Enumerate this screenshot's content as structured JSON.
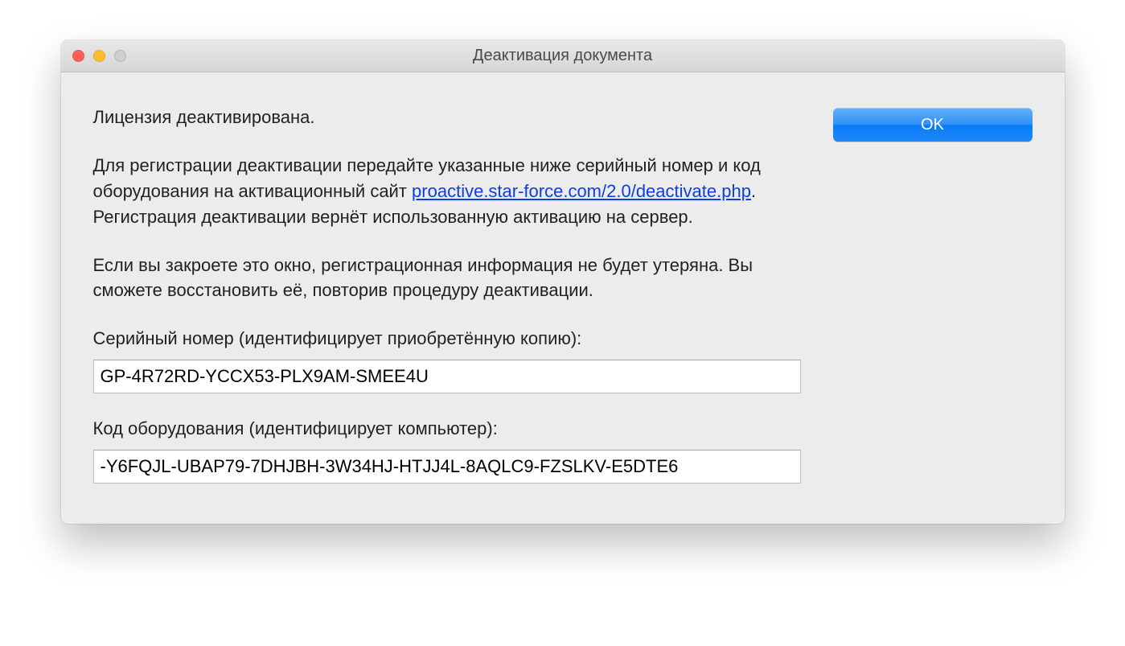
{
  "window": {
    "title": "Деактивация документа"
  },
  "body": {
    "para1": "Лицензия деактивирована.",
    "para2_before_link": "Для регистрации деактивации передайте указанные ниже серийный номер и код оборудования на активационный сайт ",
    "link_text": "proactive.star-force.com/2.0/deactivate.php",
    "para2_after_link": ". Регистрация деактивации вернёт использованную активацию на сервер.",
    "para3": "Если вы закроете это окно, регистрационная информация не будет утеряна. Вы сможете восстановить её, повторив процедуру деактивации.",
    "serial_label": "Серийный номер (идентифицирует приобретённую копию):",
    "serial_value": "GP-4R72RD-YCCX53-PLX9AM-SMEE4U",
    "hwcode_label": "Код оборудования (идентифицирует компьютер):",
    "hwcode_value": "-Y6FQJL-UBAP79-7DHJBH-3W34HJ-HTJJ4L-8AQLC9-FZSLKV-E5DTE6"
  },
  "buttons": {
    "ok": "OK"
  }
}
